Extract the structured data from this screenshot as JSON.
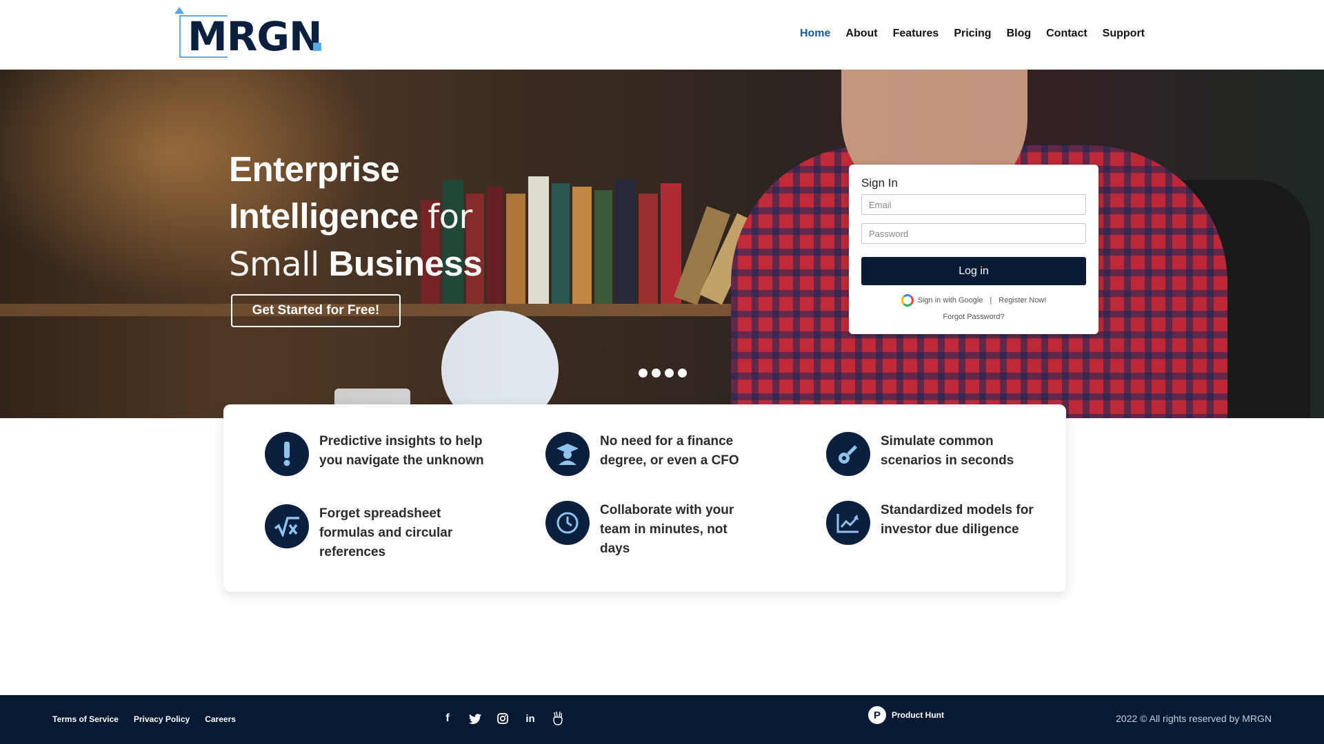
{
  "brand": {
    "logo_text": "MRGN"
  },
  "nav": [
    {
      "label": "Home",
      "active": true
    },
    {
      "label": "About"
    },
    {
      "label": "Features"
    },
    {
      "label": "Pricing"
    },
    {
      "label": "Blog"
    },
    {
      "label": "Contact"
    },
    {
      "label": "Support"
    }
  ],
  "hero": {
    "title_w1": "Enterprise",
    "title_w2": "Intelligence",
    "title_w3": "for",
    "title_w4": "Small",
    "title_w5": "Business",
    "cta_label": "Get Started for Free!",
    "slide_count": 4
  },
  "signin": {
    "title": "Sign In",
    "email_placeholder": "Email",
    "password_placeholder": "Password",
    "login_label": "Log in",
    "google_label": "Sign in with Google",
    "separator": "|",
    "register_label": "Register Now!",
    "forgot_label": "Forgot Password?"
  },
  "features": [
    {
      "icon": "exclamation-icon",
      "text": "Predictive insights to help you navigate the unknown"
    },
    {
      "icon": "graduate-icon",
      "text": "No need for a finance degree, or even a CFO"
    },
    {
      "icon": "key-icon",
      "text": "Simulate common scenarios in seconds"
    },
    {
      "icon": "formula-icon",
      "text": "Forget spreadsheet formulas and circular references"
    },
    {
      "icon": "clock-icon",
      "text": "Collaborate with your team in minutes, not days"
    },
    {
      "icon": "chart-icon",
      "text": "Standardized models for investor due diligence"
    }
  ],
  "footer": {
    "links": [
      "Terms of Service",
      "Privacy Policy",
      "Careers"
    ],
    "social": [
      "facebook-icon",
      "twitter-icon",
      "instagram-icon",
      "linkedin-icon",
      "angellist-icon"
    ],
    "product_hunt_label": "Product Hunt",
    "copyright": "2022 © All rights reserved by MRGN"
  },
  "colors": {
    "navy": "#0b1f3f",
    "accent": "#5aa9e6",
    "footer": "#071a33",
    "active_nav": "#1a5a96"
  }
}
